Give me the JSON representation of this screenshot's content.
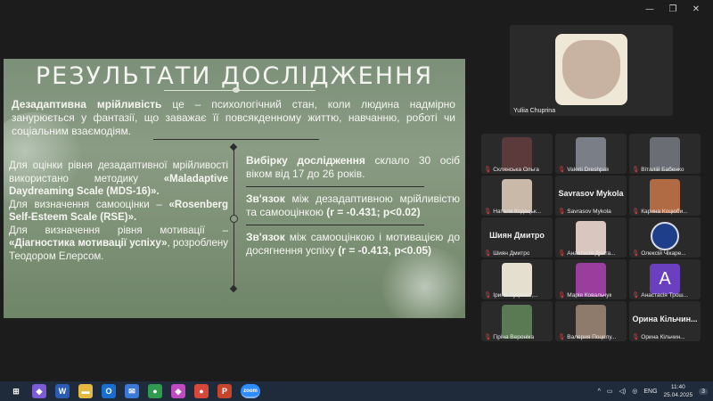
{
  "window": {
    "minimize": "—",
    "restore": "❐",
    "close": "✕"
  },
  "slide": {
    "title": "РЕЗУЛЬТАТИ ДОСЛІДЖЕННЯ",
    "intro_bold": "Дезадаптивна мрійливість",
    "intro_text": " це – психологічний стан, коли людина надмірно занурюється у фантазії, що заважає її повсякденному життю, навчанню, роботі чи соціальним взаємодіям.",
    "left": {
      "p1_text": "Для оцінки рівня дезадаптивної мрійливості використано методику ",
      "p1_bold": "«Maladaptive Daydreaming Scale (MDS-16)».",
      "p2_text": "Для визначення самооцінки – ",
      "p2_bold": "«Rosenberg Self-Esteem Scale (RSE)».",
      "p3_text": "Для визначення рівня мотивації – ",
      "p3_bold": "«Діагностика мотивації успіху»",
      "p3_tail": ", розроблену Теодором Елерсом."
    },
    "right": {
      "b1_bold": "Вибірку дослідження",
      "b1_text": " склало 30 осіб віком від 17 до 26 років.",
      "b2_bold": "Зв'язок",
      "b2_text": " між дезадаптивною мрійливістю та самооцінкою ",
      "b2_value": "(r = -0.431; p<0.02)",
      "b3_bold": "Зв'язок",
      "b3_text": " між самооцінкою і мотивацією до досягнення успіху ",
      "b3_value": "(r = -0.413, p<0.05)"
    }
  },
  "main_participant": {
    "name": "Yuliia Chuprina"
  },
  "participants": [
    {
      "name": "Склянська Ольга",
      "type": "video",
      "color": "#5a3a3a"
    },
    {
      "name": "Valerii Dreshpak",
      "type": "video",
      "color": "#7a7e86"
    },
    {
      "name": "Віталій Бабенко",
      "type": "video",
      "color": "#6a6e74"
    },
    {
      "name": "Наталя Кодацьк...",
      "type": "video",
      "color": "#c9b9a9"
    },
    {
      "name": "Savrasov Mykola",
      "type": "text",
      "big": "Savrasov Mykola"
    },
    {
      "name": "Карина Коцюби...",
      "type": "video",
      "color": "#b06a44"
    },
    {
      "name": "Шиян Дмитро",
      "type": "text",
      "big": "Шиян Дмитро"
    },
    {
      "name": "Анастасія Драга...",
      "type": "video",
      "color": "#d9c7bf"
    },
    {
      "name": "Олексій Чікаре...",
      "type": "logo"
    },
    {
      "name": "Ірина Луценко,...",
      "type": "video",
      "color": "#e4dfcf"
    },
    {
      "name": "Марія Ковальчук",
      "type": "video",
      "color": "#9a3e9e"
    },
    {
      "name": "Анастасія Трош...",
      "type": "letter",
      "letter": "A"
    },
    {
      "name": "Гіріна Вероніка",
      "type": "video",
      "color": "#5a7a54"
    },
    {
      "name": "Валерия Поцелу...",
      "type": "video",
      "color": "#8e7b6c"
    },
    {
      "name": "Орина Кільчин...",
      "type": "text",
      "big": "Орина Кільчин..."
    }
  ],
  "taskbar": {
    "apps": [
      {
        "icon": "windows-start-icon",
        "glyph": "⊞",
        "color": "#1f2a3a"
      },
      {
        "icon": "copilot-icon",
        "glyph": "◆",
        "color": "#7b5cd6"
      },
      {
        "icon": "word-icon",
        "glyph": "W",
        "color": "#2b5cb5"
      },
      {
        "icon": "file-explorer-icon",
        "glyph": "▬",
        "color": "#e5b841"
      },
      {
        "icon": "outlook-icon",
        "glyph": "O",
        "color": "#1a6ecf"
      },
      {
        "icon": "mail-icon",
        "glyph": "✉",
        "color": "#3b78d8"
      },
      {
        "icon": "chrome-icon",
        "glyph": "●",
        "color": "#2e9b4e"
      },
      {
        "icon": "paint-icon",
        "glyph": "◆",
        "color": "#c04bc0"
      },
      {
        "icon": "chrome-icon-2",
        "glyph": "●",
        "color": "#d9463a"
      },
      {
        "icon": "powerpoint-icon",
        "glyph": "P",
        "color": "#c8452b"
      },
      {
        "icon": "zoom-icon",
        "glyph": "zoom",
        "color": "#2d8cff"
      }
    ],
    "tray": {
      "chevron": "^",
      "language": "ENG",
      "time": "11:40",
      "date": "25.04.2025",
      "notification_count": "3"
    }
  }
}
